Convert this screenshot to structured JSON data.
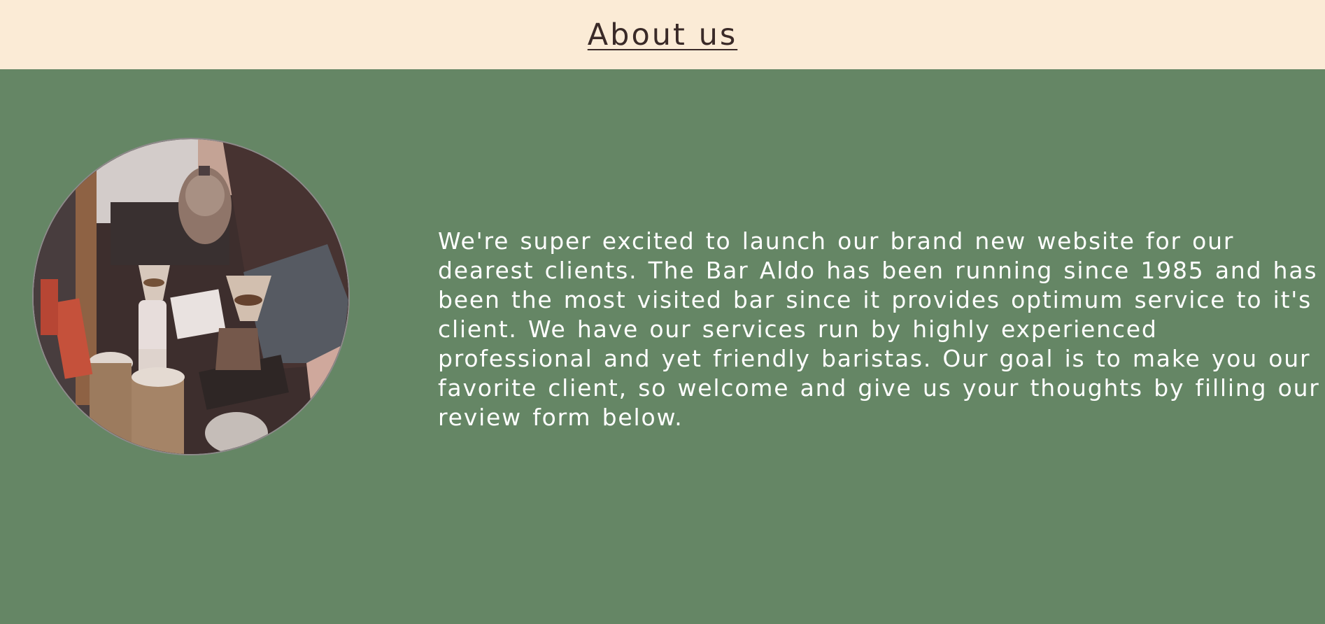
{
  "header": {
    "title": "About us"
  },
  "about": {
    "image_icon": "coffee-bar-photo",
    "paragraph": "We're super excited to launch our brand new website for our dearest clients. The Bar Aldo has been running since 1985 and has been the most visited bar since it provides optimum service to it's client. We have our services run by highly experienced professional and yet friendly baristas. Our goal is to make you our favorite client, so welcome and give us your thoughts by filling our review form below."
  },
  "colors": {
    "header_bg": "#fbebd6",
    "main_bg": "#658665",
    "title_text": "#3a2a28",
    "body_text": "#ffffff"
  }
}
